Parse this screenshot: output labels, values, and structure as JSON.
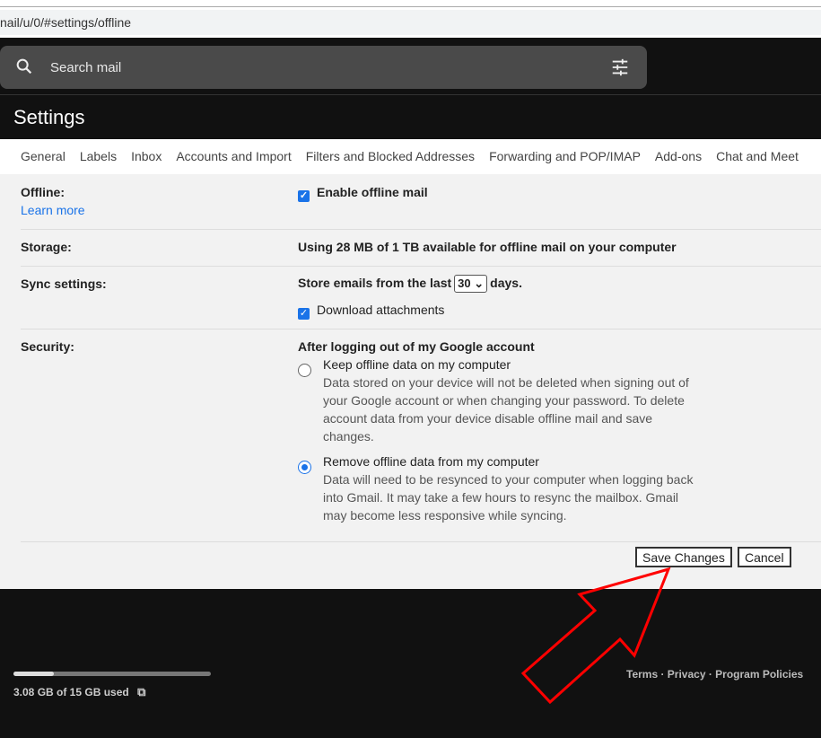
{
  "browser": {
    "url": "nail/u/0/#settings/offline"
  },
  "header": {
    "search_placeholder": "Search mail"
  },
  "settings": {
    "title": "Settings",
    "tabs": [
      "General",
      "Labels",
      "Inbox",
      "Accounts and Import",
      "Filters and Blocked Addresses",
      "Forwarding and POP/IMAP",
      "Add-ons",
      "Chat and Meet"
    ],
    "offline": {
      "label": "Offline:",
      "learn_more": "Learn more",
      "enable_label": "Enable offline mail",
      "enabled": true
    },
    "storage": {
      "label": "Storage:",
      "text": "Using 28 MB of 1 TB available for offline mail on your computer"
    },
    "sync": {
      "label": "Sync settings:",
      "prefix": "Store emails from the last",
      "days_value": "30",
      "suffix": "days.",
      "download_label": "Download attachments",
      "download_checked": true
    },
    "security": {
      "label": "Security:",
      "heading": "After logging out of my Google account",
      "options": [
        {
          "title": "Keep offline data on my computer",
          "desc": "Data stored on your device will not be deleted when signing out of your Google account or when changing your password. To delete account data from your device disable offline mail and save changes.",
          "selected": false
        },
        {
          "title": "Remove offline data from my computer",
          "desc": "Data will need to be resynced to your computer when logging back into Gmail. It may take a few hours to resync the mailbox. Gmail may become less responsive while syncing.",
          "selected": true
        }
      ]
    },
    "save_label": "Save Changes",
    "cancel_label": "Cancel"
  },
  "footer": {
    "storage_used": "3.08 GB of 15 GB used",
    "storage_fraction": 0.205,
    "links": "Terms · Privacy · Program Policies"
  },
  "annotation": {
    "arrow_color": "#ff0000"
  }
}
